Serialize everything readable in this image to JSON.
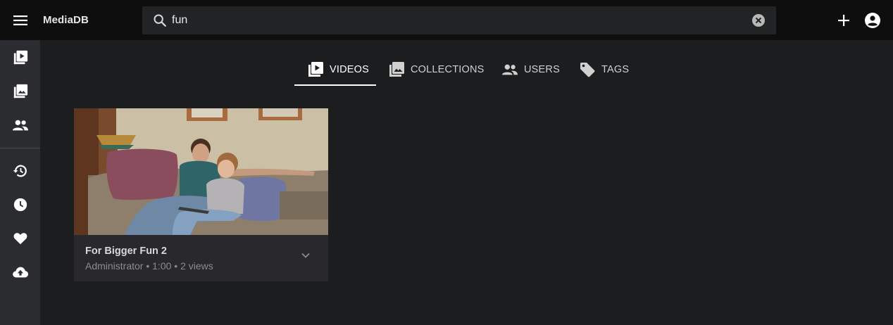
{
  "app": {
    "name": "MediaDB"
  },
  "search": {
    "value": "fun",
    "placeholder": ""
  },
  "sidebar": {
    "items": [
      {
        "icon": "video-library-icon"
      },
      {
        "icon": "collections-icon"
      },
      {
        "icon": "users-icon"
      },
      {
        "icon": "history-icon"
      },
      {
        "icon": "watch-later-icon"
      },
      {
        "icon": "favorite-icon"
      },
      {
        "icon": "upload-icon"
      }
    ]
  },
  "tabs": [
    {
      "label": "VIDEOS",
      "icon": "video-library-icon",
      "active": true
    },
    {
      "label": "COLLECTIONS",
      "icon": "collections-icon",
      "active": false
    },
    {
      "label": "USERS",
      "icon": "users-icon",
      "active": false
    },
    {
      "label": "TAGS",
      "icon": "tag-icon",
      "active": false
    }
  ],
  "results": [
    {
      "title": "For Bigger Fun 2",
      "meta": "Administrator • 1:00 • 2 views"
    }
  ],
  "colors": {
    "topbar": "#0e0e0e",
    "sidebar": "#2b2c2f",
    "background": "#1c1d1f",
    "card": "#29292d",
    "accent": "#ffffff"
  }
}
